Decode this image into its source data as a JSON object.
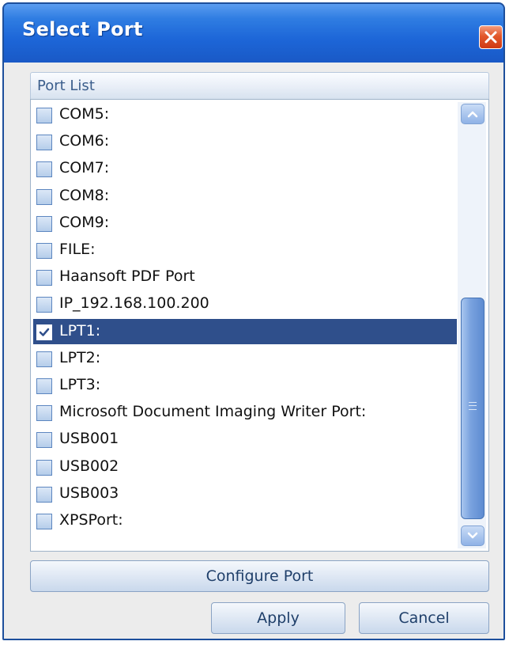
{
  "window": {
    "title": "Select Port"
  },
  "group": {
    "label": "Port List"
  },
  "ports": [
    {
      "label": "COM5:",
      "checked": false
    },
    {
      "label": "COM6:",
      "checked": false
    },
    {
      "label": "COM7:",
      "checked": false
    },
    {
      "label": "COM8:",
      "checked": false
    },
    {
      "label": "COM9:",
      "checked": false
    },
    {
      "label": "FILE:",
      "checked": false
    },
    {
      "label": "Haansoft PDF Port",
      "checked": false
    },
    {
      "label": "IP_192.168.100.200",
      "checked": false
    },
    {
      "label": "LPT1:",
      "checked": true
    },
    {
      "label": "LPT2:",
      "checked": false
    },
    {
      "label": "LPT3:",
      "checked": false
    },
    {
      "label": "Microsoft Document Imaging Writer Port:",
      "checked": false
    },
    {
      "label": "USB001",
      "checked": false
    },
    {
      "label": "USB002",
      "checked": false
    },
    {
      "label": "USB003",
      "checked": false
    },
    {
      "label": "XPSPort:",
      "checked": false
    }
  ],
  "buttons": {
    "configure": "Configure Port",
    "apply": "Apply",
    "cancel": "Cancel"
  },
  "colors": {
    "titlebar": "#1d66d8",
    "selection": "#2f4f8b",
    "close": "#e2572a"
  },
  "icons": [
    "close-icon",
    "scroll-up-icon",
    "scroll-down-icon",
    "checkmark-icon",
    "grip-icon"
  ]
}
